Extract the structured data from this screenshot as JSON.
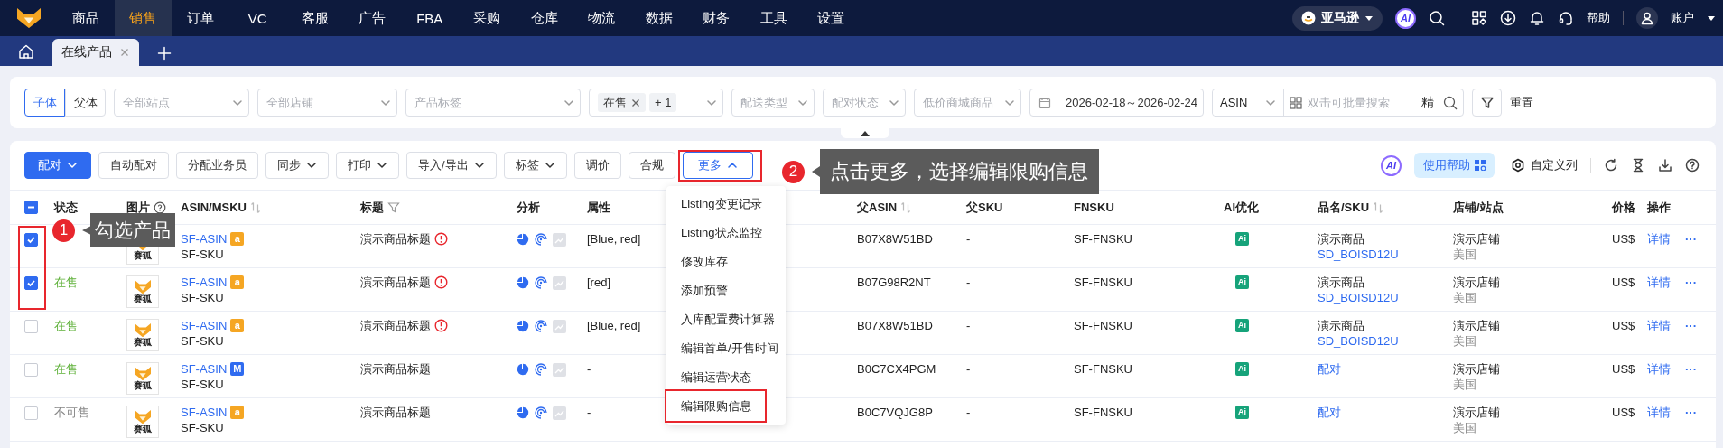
{
  "nav": {
    "items": [
      {
        "label": "商品",
        "selected": false
      },
      {
        "label": "销售",
        "selected": true
      },
      {
        "label": "订单",
        "selected": false
      },
      {
        "label": "VC",
        "selected": false
      },
      {
        "label": "客服",
        "selected": false
      },
      {
        "label": "广告",
        "selected": false
      },
      {
        "label": "FBA",
        "selected": false
      },
      {
        "label": "采购",
        "selected": false
      },
      {
        "label": "仓库",
        "selected": false
      },
      {
        "label": "物流",
        "selected": false
      },
      {
        "label": "数据",
        "selected": false
      },
      {
        "label": "财务",
        "selected": false
      },
      {
        "label": "工具",
        "selected": false
      },
      {
        "label": "设置",
        "selected": false
      }
    ],
    "marketplace": "亚马逊",
    "ai": "AI",
    "help": "帮助",
    "account": "账户"
  },
  "tabs": [
    {
      "label": "在线产品",
      "selected": true
    }
  ],
  "filters": {
    "modes": [
      {
        "label": "子体",
        "selected": true
      },
      {
        "label": "父体",
        "selected": false
      }
    ],
    "selects": [
      {
        "kind": "select",
        "placeholder": "全部站点"
      },
      {
        "kind": "select",
        "placeholder": "全部店铺"
      },
      {
        "kind": "select",
        "placeholder": "产品标签"
      },
      {
        "kind": "tags",
        "tags": [
          "在售"
        ],
        "more": "+ 1"
      },
      {
        "kind": "select",
        "placeholder": "配送类型"
      },
      {
        "kind": "select",
        "placeholder": "配对状态"
      },
      {
        "kind": "select",
        "placeholder": "低价商城商品"
      }
    ],
    "date_range": "2026-02-18～2026-02-24",
    "search_type": "ASIN",
    "search_placeholder": "双击可批量搜索",
    "precise": "精",
    "reset": "重置"
  },
  "toolbar": {
    "buttons": [
      {
        "label": "配对",
        "kind": "primary",
        "dropdown": true,
        "expanded": false,
        "highlighted": false
      },
      {
        "label": "自动配对",
        "kind": "default",
        "dropdown": false,
        "expanded": false,
        "highlighted": false
      },
      {
        "label": "分配业务员",
        "kind": "default",
        "dropdown": false,
        "expanded": false,
        "highlighted": false
      },
      {
        "label": "同步",
        "kind": "default",
        "dropdown": true,
        "expanded": false,
        "highlighted": false
      },
      {
        "label": "打印",
        "kind": "default",
        "dropdown": true,
        "expanded": false,
        "highlighted": false
      },
      {
        "label": "导入/导出",
        "kind": "default",
        "dropdown": true,
        "expanded": false,
        "highlighted": false
      },
      {
        "label": "标签",
        "kind": "default",
        "dropdown": true,
        "expanded": false,
        "highlighted": false
      },
      {
        "label": "调价",
        "kind": "default",
        "dropdown": false,
        "expanded": false,
        "highlighted": false
      },
      {
        "label": "合规",
        "kind": "default",
        "dropdown": false,
        "expanded": false,
        "highlighted": false
      },
      {
        "label": "更多",
        "kind": "default",
        "dropdown": true,
        "expanded": true,
        "highlighted": true
      }
    ],
    "ai": "AI",
    "help": "使用帮助",
    "columns": "自定义列"
  },
  "menu": {
    "items": [
      {
        "label": "Listing变更记录",
        "highlighted": false
      },
      {
        "label": "Listing状态监控",
        "highlighted": false
      },
      {
        "label": "修改库存",
        "highlighted": false
      },
      {
        "label": "添加预警",
        "highlighted": false
      },
      {
        "label": "入库配置费计算器",
        "highlighted": false
      },
      {
        "label": "编辑首单/开售时间",
        "highlighted": false
      },
      {
        "label": "编辑运营状态",
        "highlighted": false
      },
      {
        "label": "编辑限购信息",
        "highlighted": true
      }
    ]
  },
  "table": {
    "select_all_partial": true,
    "columns": [
      {
        "label": "状态",
        "sortable": false,
        "filterable": false,
        "help": false
      },
      {
        "label": "图片",
        "sortable": false,
        "filterable": false,
        "help": true
      },
      {
        "label": "ASIN/MSKU",
        "sortable": true,
        "filterable": false,
        "help": false
      },
      {
        "label": "标题",
        "sortable": false,
        "filterable": true,
        "help": false
      },
      {
        "label": "分析",
        "sortable": false,
        "filterable": false,
        "help": false
      },
      {
        "label": "属性",
        "sortable": false,
        "filterable": false,
        "help": false
      },
      {
        "label": "父ASIN",
        "sortable": true,
        "filterable": false,
        "help": false
      },
      {
        "label": "父SKU",
        "sortable": false,
        "filterable": false,
        "help": false
      },
      {
        "label": "FNSKU",
        "sortable": false,
        "filterable": false,
        "help": false
      },
      {
        "label": "AI优化",
        "sortable": false,
        "filterable": false,
        "help": false
      },
      {
        "label": "品名/SKU",
        "sortable": true,
        "filterable": false,
        "help": false
      },
      {
        "label": "店铺/站点",
        "sortable": false,
        "filterable": false,
        "help": false
      },
      {
        "label": "价格",
        "sortable": false,
        "filterable": false,
        "help": false
      }
    ],
    "actions_column": "操作",
    "rows": [
      {
        "checked": true,
        "highlighted": true,
        "image_caption": "赛狐",
        "asin": "SF-ASIN",
        "badge": {
          "text": "a",
          "color": "#f5a623"
        },
        "msku": "SF-SKU",
        "title": "演示商品标题",
        "warning": true,
        "attributes": "[Blue, red]",
        "parent_asin": "B07X8W51BD",
        "parent_sku": "-",
        "fnsku": "SF-FNSKU",
        "ai": "Ai",
        "product": {
          "kind": "product",
          "name": "演示商品",
          "sku": "SD_BOISD12U"
        },
        "store": "演示店铺",
        "site": "美国",
        "price": "US$",
        "actions": [
          "详情",
          "···"
        ]
      },
      {
        "checked": true,
        "highlighted": true,
        "status": "在售",
        "sellable": true,
        "image_caption": "赛狐",
        "asin": "SF-ASIN",
        "badge": {
          "text": "a",
          "color": "#f5a623"
        },
        "msku": "SF-SKU",
        "title": "演示商品标题",
        "warning": true,
        "attributes": "[red]",
        "parent_asin": "B07G98R2NT",
        "parent_sku": "-",
        "fnsku": "SF-FNSKU",
        "ai": "Ai",
        "product": {
          "kind": "product",
          "name": "演示商品",
          "sku": "SD_BOISD12U"
        },
        "store": "演示店铺",
        "site": "美国",
        "price": "US$",
        "actions": [
          "详情",
          "···"
        ]
      },
      {
        "checked": false,
        "highlighted": false,
        "status": "在售",
        "sellable": true,
        "image_caption": "赛狐",
        "asin": "SF-ASIN",
        "badge": {
          "text": "a",
          "color": "#f5a623"
        },
        "msku": "SF-SKU",
        "title": "演示商品标题",
        "warning": true,
        "attributes": "[Blue, red]",
        "parent_asin": "B07X8W51BD",
        "parent_sku": "-",
        "fnsku": "SF-FNSKU",
        "ai": "Ai",
        "product": {
          "kind": "product",
          "name": "演示商品",
          "sku": "SD_BOISD12U"
        },
        "store": "演示店铺",
        "site": "美国",
        "price": "US$",
        "actions": [
          "详情",
          "···"
        ]
      },
      {
        "checked": false,
        "highlighted": false,
        "status": "在售",
        "sellable": true,
        "image_caption": "赛狐",
        "asin": "SF-ASIN",
        "badge": {
          "text": "M",
          "color": "#2f6bf0"
        },
        "msku": "SF-SKU",
        "title": "演示商品标题",
        "warning": false,
        "attributes": "-",
        "parent_asin": "B0C7CX4PGM",
        "parent_sku": "-",
        "fnsku": "SF-FNSKU",
        "ai": "Ai",
        "product": {
          "kind": "unmatched",
          "link": "配对"
        },
        "store": "演示店铺",
        "site": "美国",
        "price": "US$",
        "actions": [
          "详情",
          "···"
        ]
      },
      {
        "checked": false,
        "highlighted": false,
        "status": "不可售",
        "sellable": false,
        "image_caption": "赛狐",
        "asin": "SF-ASIN",
        "badge": {
          "text": "a",
          "color": "#f5a623"
        },
        "msku": "SF-SKU",
        "title": "演示商品标题",
        "warning": false,
        "attributes": "-",
        "parent_asin": "B0C7VQJG8P",
        "parent_sku": "-",
        "fnsku": "SF-FNSKU",
        "ai": "Ai",
        "product": {
          "kind": "unmatched",
          "link": "配对"
        },
        "store": "演示店铺",
        "site": "美国",
        "price": "US$",
        "actions": [
          "详情",
          "···"
        ]
      }
    ]
  },
  "callouts": [
    {
      "number": "1",
      "text": "勾选产品"
    },
    {
      "number": "2",
      "text": "点击更多，选择编辑限购信息"
    }
  ]
}
